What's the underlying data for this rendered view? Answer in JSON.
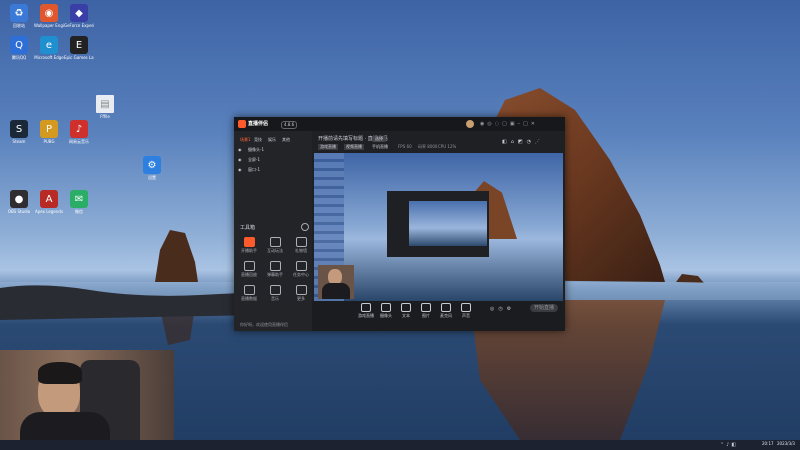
{
  "desktop": {
    "icons": [
      {
        "label": "回收站",
        "color": "#3a79d6",
        "glyph": "♻"
      },
      {
        "label": "Wallpaper Engine",
        "color": "#e0562d",
        "glyph": "◉"
      },
      {
        "label": "GeForce Experience",
        "color": "#3a3fa8",
        "glyph": "◆"
      },
      {
        "label": "腾讯QQ",
        "color": "#2d6fd6",
        "glyph": "Q"
      },
      {
        "label": "Microsoft Edge",
        "color": "#1f8fd0",
        "glyph": "e"
      },
      {
        "label": "Epic Games Launcher",
        "color": "#222222",
        "glyph": "E"
      },
      {
        "label": "Steam",
        "color": "#1b2838",
        "glyph": "S"
      },
      {
        "label": "PUBG",
        "color": "#d49a20",
        "glyph": "P"
      },
      {
        "label": "网易云音乐",
        "color": "#d0302c",
        "glyph": "♪"
      },
      {
        "label": "OBS Studio",
        "color": "#302e31",
        "glyph": "●"
      },
      {
        "label": "Apex Legends",
        "color": "#b82a24",
        "glyph": "A"
      },
      {
        "label": "微信",
        "color": "#2aae67",
        "glyph": "✉"
      }
    ],
    "file_icon_label": "Fffile",
    "settings_icon_label": "设置"
  },
  "app": {
    "brand": "直播伴侣",
    "badge": "4.8.6",
    "tabs": [
      "场景1",
      "竞技",
      "娱乐",
      "其他"
    ],
    "scenes": [
      "摄像头-1",
      "全屏-1",
      "窗口-1"
    ],
    "stream_title": "开播前请先填写标题 · 直播伴侣",
    "chip": "选择",
    "subtabs": [
      "游戏直播",
      "视频直播",
      "手机直播"
    ],
    "small_stats": [
      "FPS 60",
      "码率 8000",
      "CPU 12%"
    ],
    "toolbox_title": "工具箱",
    "tools": [
      "开播助手",
      "互动玩法",
      "礼物墙",
      "直播回放",
      "弹幕助手",
      "任务中心",
      "直播数据",
      "音乐",
      "更多"
    ],
    "notice": "你好呀，欢迎使用直播伴侣",
    "controls": [
      "游戏直播",
      "摄像头",
      "文本",
      "图片",
      "麦克风",
      "声音"
    ],
    "start_label": "开始直播"
  },
  "taskbar": {
    "time": "20:17",
    "date": "2023/3/3"
  }
}
